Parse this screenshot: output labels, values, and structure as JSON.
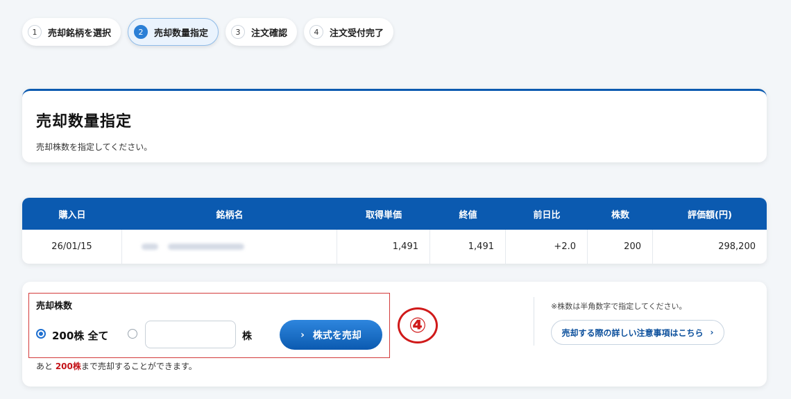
{
  "steps": [
    {
      "num": "1",
      "label": "売却銘柄を選択",
      "active": false
    },
    {
      "num": "2",
      "label": "売却数量指定",
      "active": true
    },
    {
      "num": "3",
      "label": "注文確認",
      "active": false
    },
    {
      "num": "4",
      "label": "注文受付完了",
      "active": false
    }
  ],
  "title_card": {
    "title": "売却数量指定",
    "subtitle": "売却株数を指定してください。"
  },
  "table": {
    "headers": [
      "購入日",
      "銘柄名",
      "取得単価",
      "終値",
      "前日比",
      "株数",
      "評価額(円)"
    ],
    "row": {
      "purchase_date": "26/01/15",
      "acquisition_price": "1,491",
      "close_price": "1,491",
      "change": "+2.0",
      "shares": "200",
      "value": "298,200"
    }
  },
  "order": {
    "label": "売却株数",
    "all_option": "200株 全て",
    "qty_value": "",
    "unit": "株",
    "sell_button": "株式を売却",
    "remain_prefix": "あと ",
    "remain_shares": "200株",
    "remain_suffix": "まで売却することができます。",
    "note": "※株数は半角数字で指定してください。",
    "detail_button": "売却する際の詳しい注意事項はこちら"
  },
  "annotation": "④",
  "colors": {
    "primary": "#0b5ab0",
    "accent_red": "#d01a1a"
  }
}
